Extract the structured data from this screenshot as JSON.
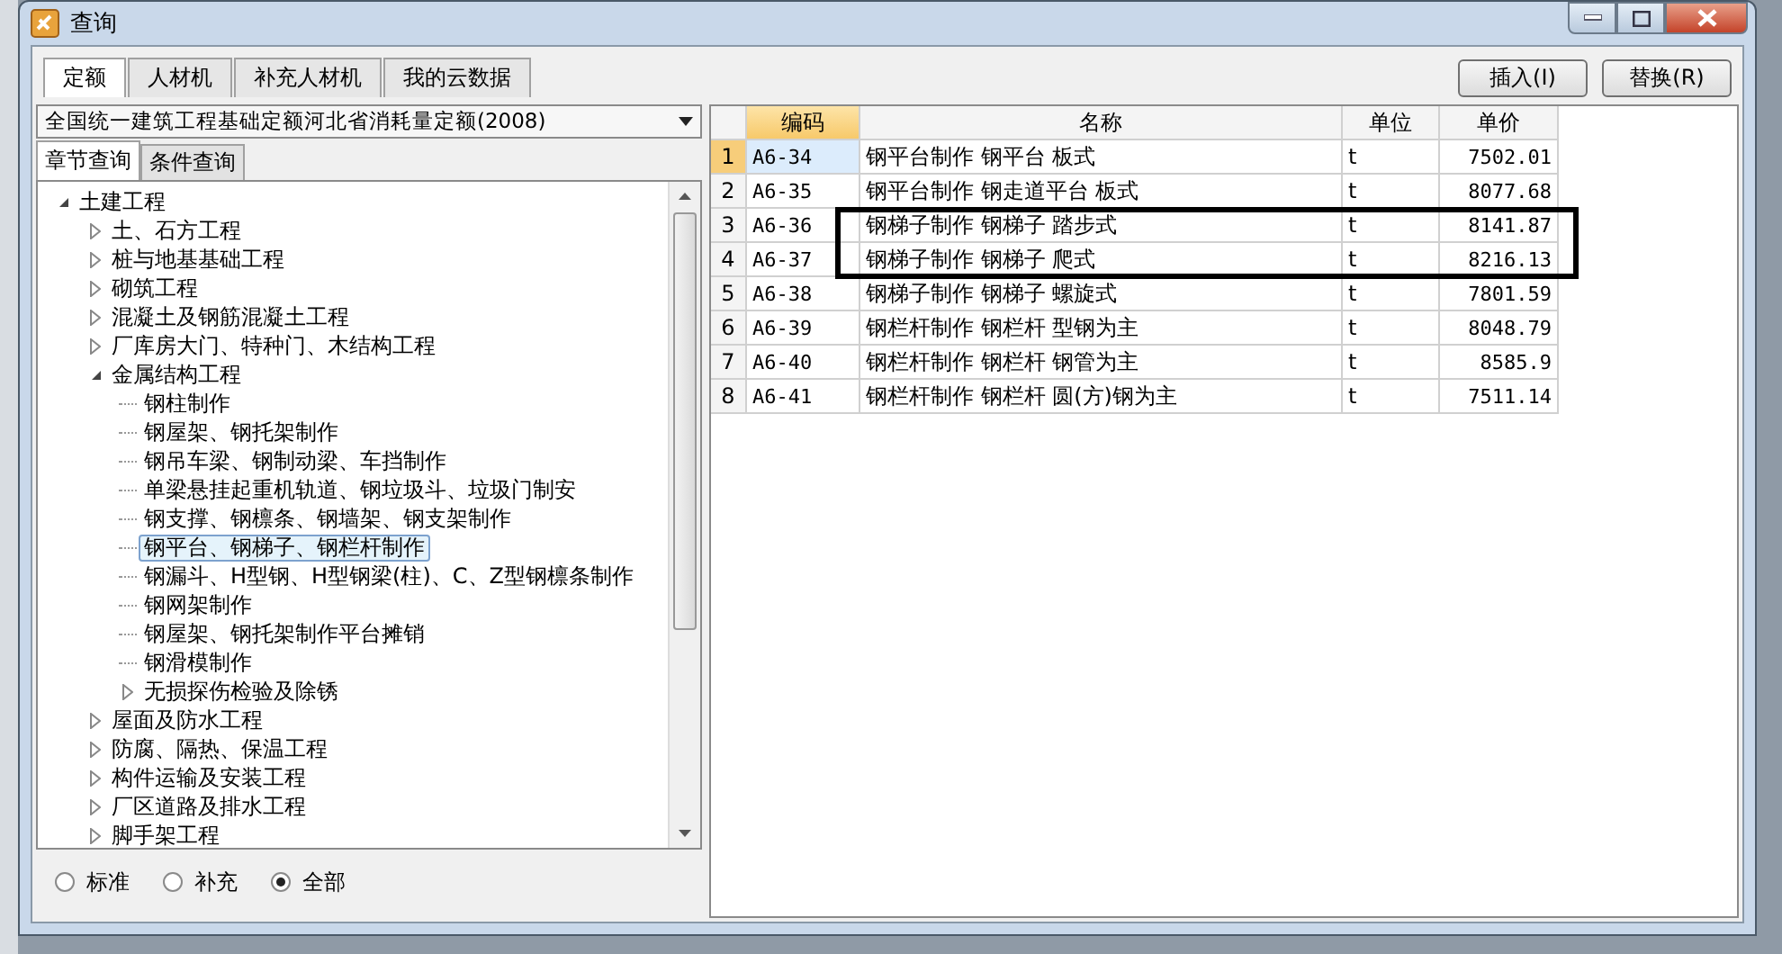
{
  "window": {
    "title": "查询"
  },
  "tabs": [
    {
      "label": "定额",
      "selected": true
    },
    {
      "label": "人材机",
      "selected": false
    },
    {
      "label": "补充人材机",
      "selected": false
    },
    {
      "label": "我的云数据",
      "selected": false
    }
  ],
  "buttons": [
    "插入(I)",
    "替换(R)"
  ],
  "quota_select": {
    "value": "全国统一建筑工程基础定额河北省消耗量定额(2008)"
  },
  "query_tabs": [
    {
      "label": "章节查询",
      "selected": true
    },
    {
      "label": "条件查询",
      "selected": false
    }
  ],
  "tree": [
    {
      "label": "土建工程",
      "expanded": true,
      "selected": false,
      "children": [
        {
          "label": "土、石方工程",
          "expanded": false,
          "selected": false
        },
        {
          "label": "桩与地基基础工程",
          "expanded": false,
          "selected": false
        },
        {
          "label": "砌筑工程",
          "expanded": false,
          "selected": false
        },
        {
          "label": "混凝土及钢筋混凝土工程",
          "expanded": false,
          "selected": false
        },
        {
          "label": "厂库房大门、特种门、木结构工程",
          "expanded": false,
          "selected": false
        },
        {
          "label": "金属结构工程",
          "expanded": true,
          "selected": false,
          "children": [
            {
              "label": "钢柱制作",
              "selected": false
            },
            {
              "label": "钢屋架、钢托架制作",
              "selected": false
            },
            {
              "label": "钢吊车梁、钢制动梁、车挡制作",
              "selected": false
            },
            {
              "label": "单梁悬挂起重机轨道、钢垃圾斗、垃圾门制安",
              "selected": false
            },
            {
              "label": "钢支撑、钢檩条、钢墙架、钢支架制作",
              "selected": false
            },
            {
              "label": "钢平台、钢梯子、钢栏杆制作",
              "selected": true
            },
            {
              "label": "钢漏斗、H型钢、H型钢梁(柱)、C、Z型钢檩条制作",
              "selected": false
            },
            {
              "label": "钢网架制作",
              "selected": false
            },
            {
              "label": "钢屋架、钢托架制作平台摊销",
              "selected": false
            },
            {
              "label": "钢滑模制作",
              "selected": false
            },
            {
              "label": "无损探伤检验及除锈",
              "expanded": false,
              "selected": false
            }
          ]
        },
        {
          "label": "屋面及防水工程",
          "expanded": false,
          "selected": false
        },
        {
          "label": "防腐、隔热、保温工程",
          "expanded": false,
          "selected": false
        },
        {
          "label": "构件运输及安装工程",
          "expanded": false,
          "selected": false
        },
        {
          "label": "厂区道路及排水工程",
          "expanded": false,
          "selected": false
        },
        {
          "label": "脚手架工程",
          "expanded": false,
          "selected": false
        }
      ]
    }
  ],
  "filter": [
    {
      "label": "标准",
      "selected": false
    },
    {
      "label": "补充",
      "selected": false
    },
    {
      "label": "全部",
      "selected": true
    }
  ],
  "table": {
    "columns": [
      "编码",
      "名称",
      "单位",
      "单价"
    ],
    "rows": [
      {
        "num": "1",
        "code": "A6-34",
        "name": "钢平台制作 钢平台 板式",
        "unit": "t",
        "price": "7502.01",
        "selected": true,
        "highlighted": false
      },
      {
        "num": "2",
        "code": "A6-35",
        "name": "钢平台制作 钢走道平台 板式",
        "unit": "t",
        "price": "8077.68",
        "selected": false,
        "highlighted": false
      },
      {
        "num": "3",
        "code": "A6-36",
        "name": "钢梯子制作 钢梯子 踏步式",
        "unit": "t",
        "price": "8141.87",
        "selected": false,
        "highlighted": true
      },
      {
        "num": "4",
        "code": "A6-37",
        "name": "钢梯子制作 钢梯子 爬式",
        "unit": "t",
        "price": "8216.13",
        "selected": false,
        "highlighted": true
      },
      {
        "num": "5",
        "code": "A6-38",
        "name": "钢梯子制作 钢梯子 螺旋式",
        "unit": "t",
        "price": "7801.59",
        "selected": false,
        "highlighted": false
      },
      {
        "num": "6",
        "code": "A6-39",
        "name": "钢栏杆制作 钢栏杆 型钢为主",
        "unit": "t",
        "price": "8048.79",
        "selected": false,
        "highlighted": false
      },
      {
        "num": "7",
        "code": "A6-40",
        "name": "钢栏杆制作 钢栏杆 钢管为主",
        "unit": "t",
        "price": "8585.9",
        "selected": false,
        "highlighted": false
      },
      {
        "num": "8",
        "code": "A6-41",
        "name": "钢栏杆制作 钢栏杆 圆(方)钢为主",
        "unit": "t",
        "price": "7511.14",
        "selected": false,
        "highlighted": false
      }
    ]
  }
}
